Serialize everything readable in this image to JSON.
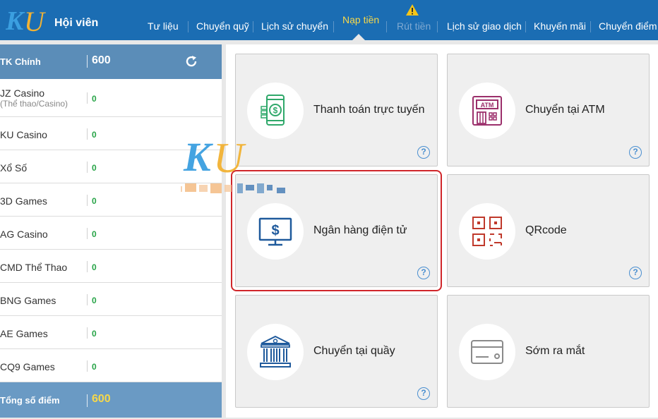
{
  "header": {
    "brand": "Hội viên",
    "logo_text": "KU",
    "nav": [
      {
        "label": "Tư liệu"
      },
      {
        "label": "Chuyển quỹ"
      },
      {
        "label": "Lịch sử chuyển"
      },
      {
        "label": "Nạp tiền",
        "active": true
      },
      {
        "label": "Rút tiền",
        "disabled": true
      },
      {
        "label": "Lịch sử giao dịch"
      },
      {
        "label": "Khuyến mãi"
      },
      {
        "label": "Chuyển điểm"
      }
    ]
  },
  "sidebar": {
    "main_account": {
      "label": "TK Chính",
      "value": "600"
    },
    "rows": [
      {
        "label": "JZ Casino",
        "sub": "(Thể thao/Casino)",
        "value": "0"
      },
      {
        "label": "KU Casino",
        "value": "0"
      },
      {
        "label": "Xổ Số",
        "value": "0"
      },
      {
        "label": "3D Games",
        "value": "0"
      },
      {
        "label": "AG Casino",
        "value": "0"
      },
      {
        "label": "CMD Thể Thao",
        "value": "0"
      },
      {
        "label": "BNG Games",
        "value": "0"
      },
      {
        "label": "AE Games",
        "value": "0"
      },
      {
        "label": "CQ9 Games",
        "value": "0"
      }
    ],
    "total": {
      "label": "Tổng số điểm",
      "value": "600"
    }
  },
  "deposit_methods": [
    {
      "label": "Thanh toán trực tuyến",
      "icon": "mobile-payment-icon"
    },
    {
      "label": "Chuyển tại ATM",
      "icon": "atm-icon"
    },
    {
      "label": "Ngân hàng điện tử",
      "icon": "online-banking-icon",
      "selected": true
    },
    {
      "label": "QRcode",
      "icon": "qrcode-icon"
    },
    {
      "label": "Chuyển tại quầy",
      "icon": "bank-counter-icon"
    },
    {
      "label": "Sớm ra mắt",
      "icon": "card-icon"
    }
  ],
  "help_symbol": "?",
  "colors": {
    "header_bg": "#1b6db3",
    "active_nav": "#f7d84a",
    "value_green": "#26a346",
    "highlight_red": "#d0262a",
    "icon_green": "#2fa86a",
    "icon_blue": "#1f5a9c",
    "icon_red": "#c0392b"
  }
}
